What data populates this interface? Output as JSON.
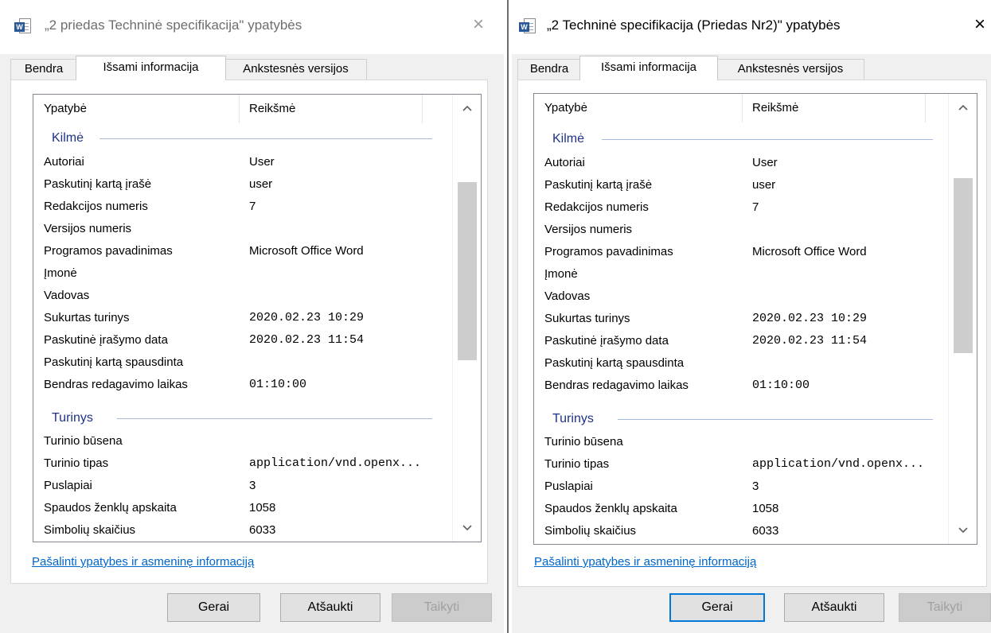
{
  "left_dialog": {
    "title": "„2 priedas Techninė specifikacija\" ypatybės",
    "close_glyph": "×",
    "tabs": [
      "Bendra",
      "Išsami informacija",
      "Ankstesnės versijos"
    ],
    "columns": [
      "Ypatybė",
      "Reikšmė"
    ],
    "groups": [
      "Kilmė",
      "Turinys"
    ],
    "origin_rows": [
      {
        "k": "Autoriai",
        "v": "User"
      },
      {
        "k": "Paskutinį kartą įrašė",
        "v": "user"
      },
      {
        "k": "Redakcijos numeris",
        "v": "7"
      },
      {
        "k": "Versijos numeris",
        "v": ""
      },
      {
        "k": "Programos pavadinimas",
        "v": "Microsoft Office Word"
      },
      {
        "k": "Įmonė",
        "v": ""
      },
      {
        "k": "Vadovas",
        "v": ""
      },
      {
        "k": "Sukurtas turinys",
        "v": "2020.02.23 10:29"
      },
      {
        "k": "Paskutinė įrašymo data",
        "v": "2020.02.23 11:54"
      },
      {
        "k": "Paskutinį kartą spausdinta",
        "v": ""
      },
      {
        "k": "Bendras redagavimo laikas",
        "v": "01:10:00"
      }
    ],
    "content_rows": [
      {
        "k": "Turinio būsena",
        "v": ""
      },
      {
        "k": "Turinio tipas",
        "v": "application/vnd.openx..."
      },
      {
        "k": "Puslapiai",
        "v": "3"
      },
      {
        "k": "Spaudos ženklų apskaita",
        "v": "1058"
      },
      {
        "k": "Simbolių skaičius",
        "v": "6033"
      }
    ],
    "remove_link": "Pašalinti ypatybes ir asmeninę informaciją",
    "buttons": {
      "ok": "Gerai",
      "cancel": "Atšaukti",
      "apply": "Taikyti"
    }
  },
  "right_dialog": {
    "title": "„2 Techninė specifikacija (Priedas Nr2)\" ypatybės",
    "close_glyph": "×",
    "tabs": [
      "Bendra",
      "Išsami informacija",
      "Ankstesnės versijos"
    ],
    "columns": [
      "Ypatybė",
      "Reikšmė"
    ],
    "groups": [
      "Kilmė",
      "Turinys"
    ],
    "origin_rows": [
      {
        "k": "Autoriai",
        "v": "User"
      },
      {
        "k": "Paskutinį kartą įrašė",
        "v": "user"
      },
      {
        "k": "Redakcijos numeris",
        "v": "7"
      },
      {
        "k": "Versijos numeris",
        "v": ""
      },
      {
        "k": "Programos pavadinimas",
        "v": "Microsoft Office Word"
      },
      {
        "k": "Įmonė",
        "v": ""
      },
      {
        "k": "Vadovas",
        "v": ""
      },
      {
        "k": "Sukurtas turinys",
        "v": "2020.02.23 10:29"
      },
      {
        "k": "Paskutinė įrašymo data",
        "v": "2020.02.23 11:54"
      },
      {
        "k": "Paskutinį kartą spausdinta",
        "v": ""
      },
      {
        "k": "Bendras redagavimo laikas",
        "v": "01:10:00"
      }
    ],
    "content_rows": [
      {
        "k": "Turinio būsena",
        "v": ""
      },
      {
        "k": "Turinio tipas",
        "v": "application/vnd.openx..."
      },
      {
        "k": "Puslapiai",
        "v": "3"
      },
      {
        "k": "Spaudos ženklų apskaita",
        "v": "1058"
      },
      {
        "k": "Simbolių skaičius",
        "v": "6033"
      }
    ],
    "remove_link": "Pašalinti ypatybes ir asmeninę informaciją",
    "buttons": {
      "ok": "Gerai",
      "cancel": "Atšaukti",
      "apply": "Taikyti"
    }
  },
  "icons": {
    "app": "word-document-icon",
    "close": "close-icon",
    "scroll_up": "chevron-up-icon",
    "scroll_down": "chevron-down-icon"
  },
  "colors": {
    "link": "#0066cc",
    "group_header": "#1e3287",
    "default_button_border": "#0078d7"
  }
}
